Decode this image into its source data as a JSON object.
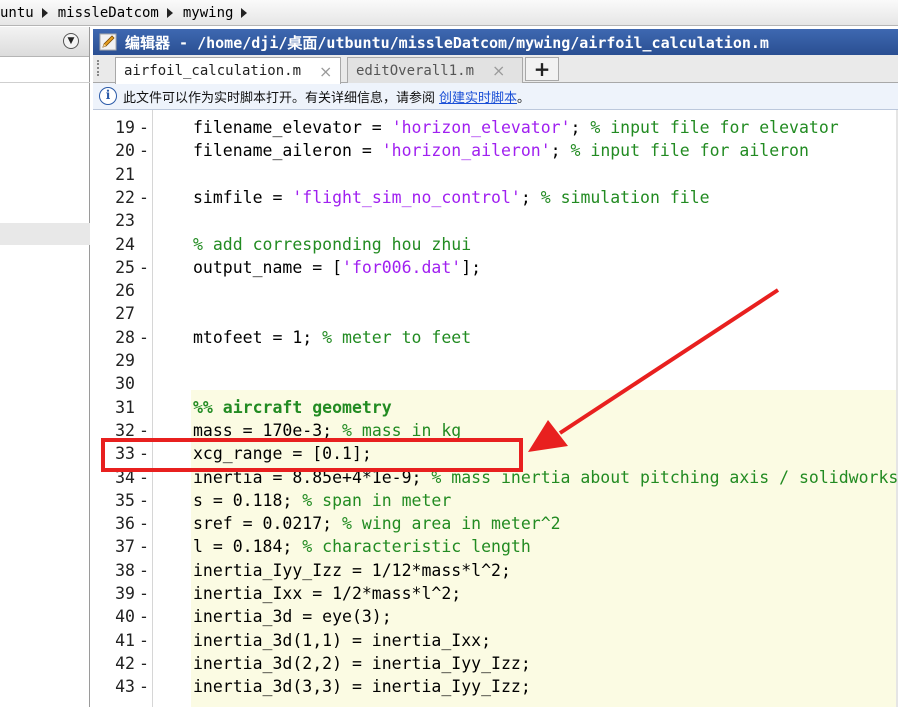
{
  "breadcrumb": {
    "segments": [
      "untu",
      "missleDatcom",
      "mywing"
    ]
  },
  "left_panel": {
    "dropdown_icon": "chevron-down-icon"
  },
  "editor": {
    "title": "编辑器 - /home/dji/桌面/utbuntu/missleDatcom/mywing/airfoil_calculation.m",
    "tabs": [
      {
        "label": "airfoil_calculation.m",
        "active": true
      },
      {
        "label": "editOverall1.m",
        "active": false
      }
    ],
    "add_tab_label": "+",
    "close_glyph": "⨯"
  },
  "infobar": {
    "text": "此文件可以作为实时脚本打开。有关详细信息，请参阅",
    "link": "创建实时脚本",
    "suffix": "。"
  },
  "code_lines": [
    {
      "n": "19",
      "dash": "-",
      "text": [
        [
          "filename_elevator = ",
          ""
        ],
        [
          "'horizon_elevator'",
          "s"
        ],
        [
          "; ",
          ""
        ],
        [
          "% input file for elevator",
          "c"
        ]
      ]
    },
    {
      "n": "20",
      "dash": "-",
      "text": [
        [
          "filename_aileron = ",
          ""
        ],
        [
          "'horizon_aileron'",
          "s"
        ],
        [
          "; ",
          ""
        ],
        [
          "% input file for aileron",
          "c"
        ]
      ]
    },
    {
      "n": "21",
      "dash": "",
      "text": []
    },
    {
      "n": "22",
      "dash": "-",
      "text": [
        [
          "simfile = ",
          ""
        ],
        [
          "'flight_sim_no_control'",
          "s"
        ],
        [
          "; ",
          ""
        ],
        [
          "% simulation file",
          "c"
        ]
      ]
    },
    {
      "n": "23",
      "dash": "",
      "text": []
    },
    {
      "n": "24",
      "dash": "",
      "text": [
        [
          "% add corresponding hou zhui",
          "c"
        ]
      ]
    },
    {
      "n": "25",
      "dash": "-",
      "text": [
        [
          "output_name = [",
          ""
        ],
        [
          "'for006.dat'",
          "s"
        ],
        [
          "];",
          ""
        ]
      ]
    },
    {
      "n": "26",
      "dash": "",
      "text": []
    },
    {
      "n": "27",
      "dash": "",
      "text": []
    },
    {
      "n": "28",
      "dash": "-",
      "text": [
        [
          "mtofeet = 1; ",
          ""
        ],
        [
          "% meter to feet",
          "c"
        ]
      ]
    },
    {
      "n": "29",
      "dash": "",
      "text": []
    },
    {
      "n": "30",
      "dash": "",
      "text": []
    },
    {
      "n": "31",
      "dash": "",
      "text": [
        [
          "%% aircraft geometry",
          "cb"
        ]
      ]
    },
    {
      "n": "32",
      "dash": "-",
      "text": [
        [
          "mass = 170e-3; ",
          ""
        ],
        [
          "% mass in kg",
          "c"
        ]
      ]
    },
    {
      "n": "33",
      "dash": "-",
      "text": [
        [
          "xcg_range = [0.1];",
          ""
        ]
      ]
    },
    {
      "n": "34",
      "dash": "-",
      "text": [
        [
          "inertia = 8.85e+4*1e-9; ",
          ""
        ],
        [
          "% mass inertia about pitching axis / solidworks",
          "c"
        ]
      ]
    },
    {
      "n": "35",
      "dash": "-",
      "text": [
        [
          "s = 0.118; ",
          ""
        ],
        [
          "% span in meter",
          "c"
        ]
      ]
    },
    {
      "n": "36",
      "dash": "-",
      "text": [
        [
          "sref = 0.0217; ",
          ""
        ],
        [
          "% wing area in meter^2",
          "c"
        ]
      ]
    },
    {
      "n": "37",
      "dash": "-",
      "text": [
        [
          "l = 0.184; ",
          ""
        ],
        [
          "% characteristic length",
          "c"
        ]
      ]
    },
    {
      "n": "38",
      "dash": "-",
      "text": [
        [
          "inertia_Iyy_Izz = 1/12*mass*l^2;",
          ""
        ]
      ]
    },
    {
      "n": "39",
      "dash": "-",
      "text": [
        [
          "inertia_Ixx = 1/2*mass*l^2;",
          ""
        ]
      ]
    },
    {
      "n": "40",
      "dash": "-",
      "text": [
        [
          "inertia_3d = eye(3);",
          ""
        ]
      ]
    },
    {
      "n": "41",
      "dash": "-",
      "text": [
        [
          "inertia_3d(1,1) = inertia_Ixx;",
          ""
        ]
      ]
    },
    {
      "n": "42",
      "dash": "-",
      "text": [
        [
          "inertia_3d(2,2) = inertia_Iyy_Izz;",
          ""
        ]
      ]
    },
    {
      "n": "43",
      "dash": "-",
      "text": [
        [
          "inertia_3d(3,3) = inertia_Iyy_Izz;",
          ""
        ]
      ]
    }
  ],
  "annotation": {
    "color": "#e8201f",
    "highlighted_line": "33"
  }
}
